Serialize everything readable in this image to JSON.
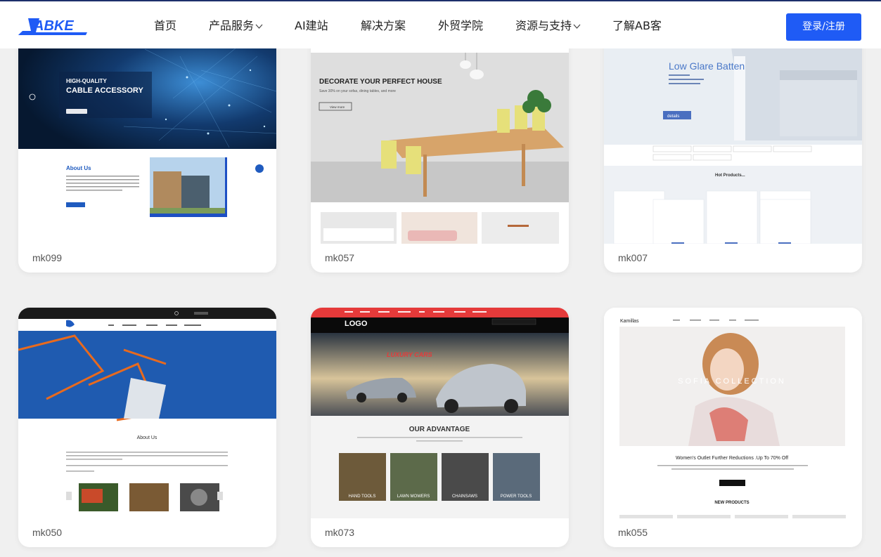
{
  "header": {
    "logo_text": "ABKE",
    "nav": [
      {
        "label": "首页",
        "has_dropdown": false
      },
      {
        "label": "产品服务",
        "has_dropdown": true
      },
      {
        "label": "AI建站",
        "has_dropdown": false
      },
      {
        "label": "解决方案",
        "has_dropdown": false
      },
      {
        "label": "外贸学院",
        "has_dropdown": false
      },
      {
        "label": "资源与支持",
        "has_dropdown": true
      },
      {
        "label": "了解AB客",
        "has_dropdown": false
      }
    ],
    "login_label": "登录/注册"
  },
  "colors": {
    "brand_blue": "#1f5bf5",
    "header_border": "#1d2f6b",
    "page_bg": "#f0f0f0"
  },
  "templates": [
    {
      "id": "mk099",
      "preview": {
        "hero_line1": "HIGH-QUALITY",
        "hero_line2": "CABLE ACCESSORY",
        "section_title": "About Us"
      }
    },
    {
      "id": "mk057",
      "preview": {
        "hero_title": "DECORATE YOUR PERFECT HOUSE",
        "hero_sub": "Save 30% on your sofas, dining tables, and more",
        "button": "View more"
      }
    },
    {
      "id": "mk007",
      "preview": {
        "hero_title": "Low Glare Batten",
        "button": "details",
        "section_title": "Hot Products..."
      }
    },
    {
      "id": "mk050",
      "preview": {
        "section_title": "About Us"
      }
    },
    {
      "id": "mk073",
      "preview": {
        "logo": "LOGO",
        "hero_title": "LUXURY CARS",
        "section_title": "OUR ADVANTAGE",
        "tiles": [
          "HAND TOOLS",
          "LAWN MOWERS",
          "CHAINSAWS",
          "POWER TOOLS"
        ]
      }
    },
    {
      "id": "mk055",
      "preview": {
        "brand": "Kamillas",
        "hero_title": "SOFIA COLLECTION",
        "promo": "Women's Outlet Further Reductions .Up To 70% Off",
        "section_title": "NEW PRODUCTS"
      }
    }
  ]
}
